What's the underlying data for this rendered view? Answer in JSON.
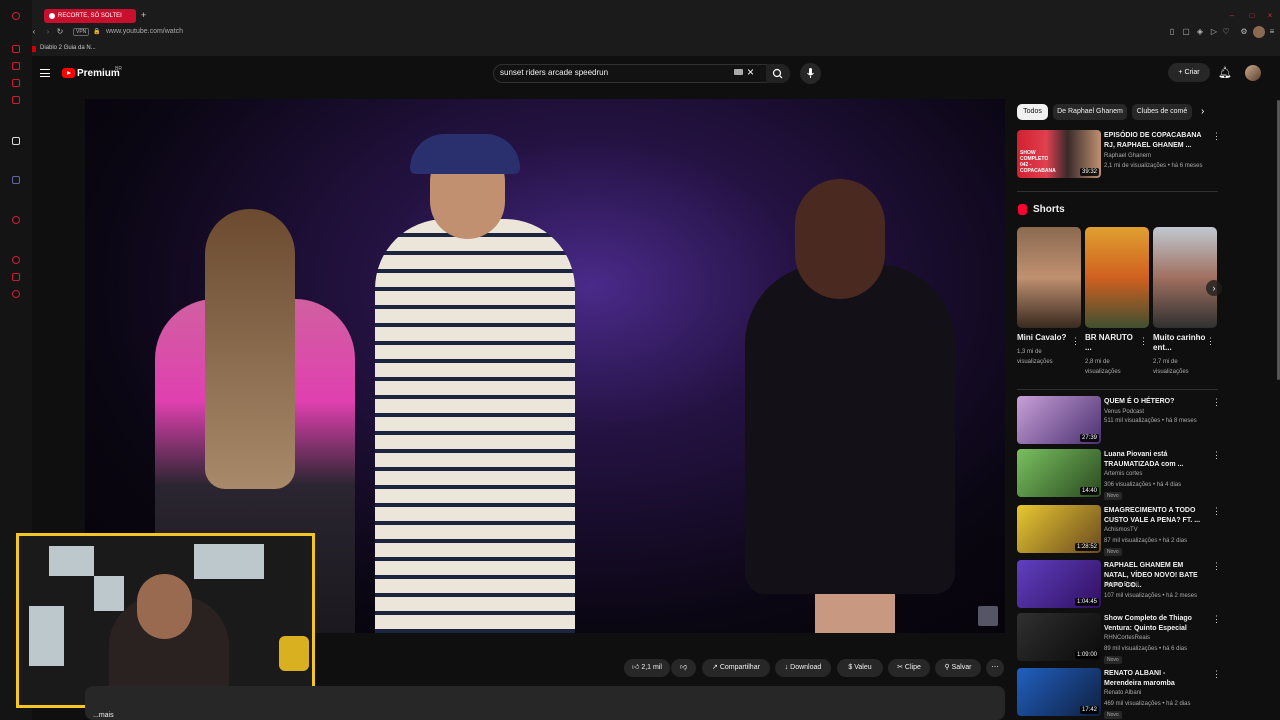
{
  "browser": {
    "tab_title": "RECORTE, SÓ SOLTEI",
    "new_tab": "+",
    "bookmark": "Diablo 2 Guia da N...",
    "url": "www.youtube.com/watch",
    "vpn": "VPN"
  },
  "header": {
    "brand": "Premium",
    "brand_sup": "BR",
    "search_query": "sunset riders arcade speedrun",
    "create_label": "Criar"
  },
  "actions": {
    "likes": "2,1 mil",
    "share": "Compartilhar",
    "download": "Download",
    "thanks": "Valeu",
    "clip": "Clipe",
    "save": "Salvar",
    "more": "...mais"
  },
  "chips": [
    "Todos",
    "De Raphael Ghanem",
    "Clubes de comé"
  ],
  "top_video": {
    "title": "EPISÓDIO DE COPACABANA RJ, RAPHAEL GHANEM ...",
    "channel": "Raphael Ghanem",
    "meta": "2,1 mi de visualizações • há 6 meses",
    "duration": "39:32",
    "thumb_text": "SHOW COMPLETO 042 - COPACABANA"
  },
  "shorts": {
    "heading": "Shorts",
    "items": [
      {
        "title": "Mini Cavalo?",
        "meta": "1,3 mi de visualizações"
      },
      {
        "title": "BR NARUTO ...",
        "meta": "2,8 mi de visualizações"
      },
      {
        "title": "Muito carinho ent...",
        "meta": "2,7 mi de visualizações"
      }
    ]
  },
  "videos": [
    {
      "title": "QUEM É O HÉTERO?",
      "channel": "Venus Podcast",
      "meta": "511 mil visualizações • há 8 meses",
      "duration": "27:39",
      "new": "",
      "colors": [
        "#c8a0d8",
        "#4a3070"
      ]
    },
    {
      "title": "Luana Piovani está TRAUMATIZADA com ...",
      "channel": "Artemis cortes",
      "meta": "306 visualizações • há 4 dias",
      "duration": "14:40",
      "new": "Novo",
      "colors": [
        "#7ac060",
        "#2a4a20"
      ]
    },
    {
      "title": "EMAGRECIMENTO A TODO CUSTO VALE A PENA? FT. ...",
      "channel": "AchismosTV",
      "meta": "87 mil visualizações • há 2 dias",
      "duration": "1:28:52",
      "new": "Novo",
      "colors": [
        "#e8c830",
        "#6a4a20"
      ]
    },
    {
      "title": "RAPHAEL GHANEM EM NATAL, VÍDEO NOVO! BATE PAPO CO...",
      "channel": "Humor Brasil",
      "meta": "107 mil visualizações • há 2 meses",
      "duration": "1:04:45",
      "new": "",
      "colors": [
        "#6040c0",
        "#301060"
      ]
    },
    {
      "title": "Show Completo de Thiago Ventura: Quinto Especial",
      "channel": "RHNCortesReais",
      "meta": "89 mil visualizações • há 6 dias",
      "duration": "1:09:00",
      "new": "Novo",
      "colors": [
        "#303030",
        "#0a0a0a"
      ]
    },
    {
      "title": "RENATO ALBANI - Merendeira maromba",
      "channel": "Renato Albani",
      "meta": "469 mil visualizações • há 2 dias",
      "duration": "17:42",
      "new": "Novo",
      "colors": [
        "#2060c0",
        "#102040"
      ]
    }
  ]
}
